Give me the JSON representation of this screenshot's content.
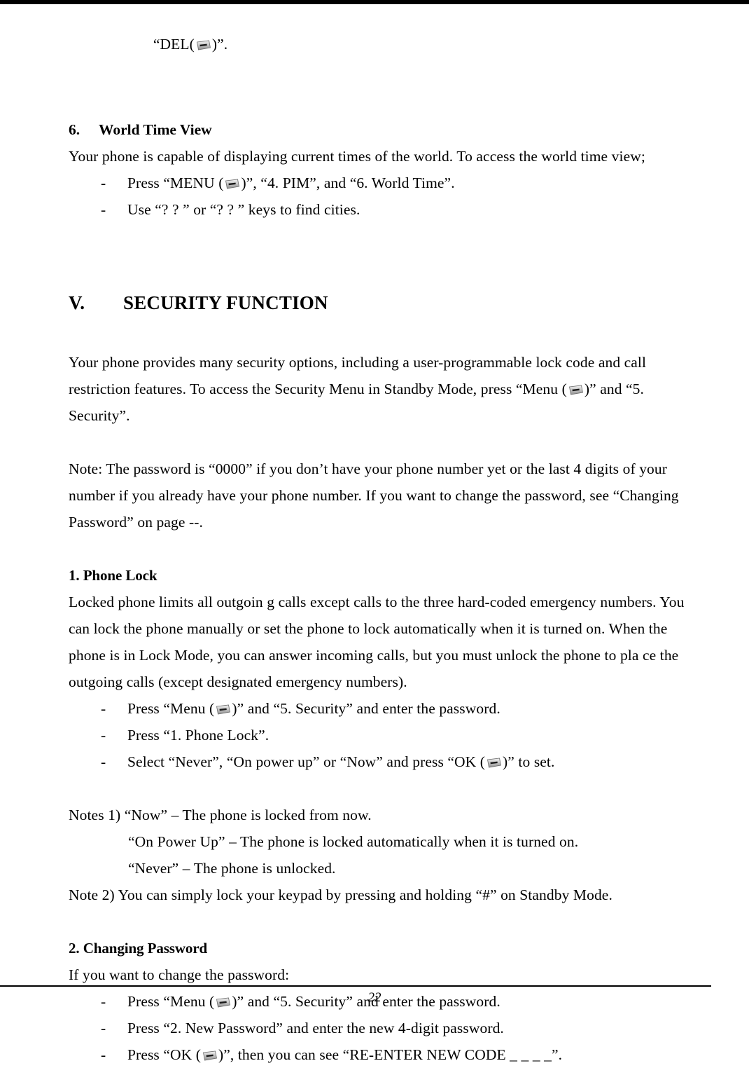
{
  "document": {
    "page_number": "22",
    "icon_name": "phone-key-icon"
  },
  "top_line": {
    "prefix": "“DEL(",
    "suffix": ")”."
  },
  "section6": {
    "number": "6.",
    "title": "World Time View",
    "intro": "Your phone is capable of displaying current times of the world. To access the world time view;",
    "bullets": [
      {
        "dash": "-",
        "pre": "Press “MENU (",
        "post": ")”, “4. PIM”, and “6. World Time”."
      },
      {
        "dash": "-",
        "text": "Use “?  ?  ” or “?  ?  ” keys to find cities."
      }
    ]
  },
  "section5": {
    "roman": "V.",
    "title": "SECURITY FUNCTION",
    "intro_pre": "Your phone provides many security options, including a user-programmable lock code and call restriction features. To access the Security Menu in Standby Mode, press “Menu (",
    "intro_post": ")” and “5. Security”.",
    "note": "Note: The password is “0000” if you don’t have your phone number yet or the last 4 digits of your number if you already have your phone number. If you want to change the password, see “Changing Password” on page --."
  },
  "phone_lock": {
    "heading": "1. Phone Lock",
    "body": "Locked phone limits all outgoin g calls except calls to the three hard-coded emergency numbers. You can lock the phone manually or set the phone to lock automatically when it is turned on. When the phone is in Lock Mode, you can answer incoming calls, but you must unlock the phone to pla ce the outgoing calls (except designated emergency numbers).",
    "bullets": [
      {
        "dash": "-",
        "pre": "Press “Menu (",
        "post": ")” and “5. Security” and enter the password."
      },
      {
        "dash": "-",
        "text": "Press “1. Phone Lock”."
      },
      {
        "dash": "-",
        "pre": "Select “Never”, “On power up” or “Now” and press “OK (",
        "post": ")” to set."
      }
    ],
    "notes": [
      "Notes 1) “Now” – The phone is locked from now.",
      "“On Power Up” – The phone is locked automatically when it is turned on.",
      "“Never” – The phone is unlocked.",
      "Note 2) You can simply lock your keypad by pressing and holding “#” on Standby Mode."
    ]
  },
  "changing_password": {
    "heading": "2. Changing Password",
    "intro": "If you want to change the password:",
    "bullets": [
      {
        "dash": "-",
        "pre": "Press “Menu (",
        "post": ")” and “5. Security” and enter the password."
      },
      {
        "dash": "-",
        "text": "Press “2. New Password” and enter the new 4-digit password."
      },
      {
        "dash": "-",
        "pre": "Press “OK (",
        "post": ")”, then you can see “RE-ENTER NEW CODE  _ _ _ _”."
      }
    ]
  }
}
